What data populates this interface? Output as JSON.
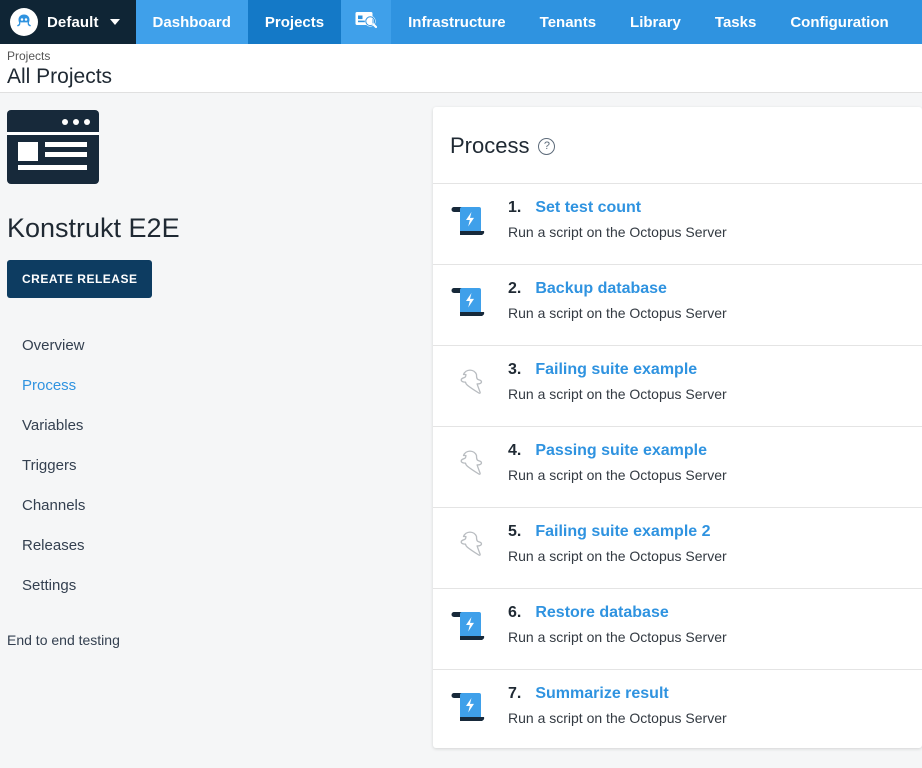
{
  "topnav": {
    "brand": {
      "label": "Default",
      "avatar_icon": "octopus-avatar-icon",
      "caret_icon": "chevron-down-icon"
    },
    "items": [
      {
        "label": "Dashboard",
        "state": "highlight"
      },
      {
        "label": "Projects",
        "state": "active"
      },
      {
        "label": "",
        "state": "highlight",
        "icon": "search-card-icon"
      },
      {
        "label": "Infrastructure",
        "state": "normal"
      },
      {
        "label": "Tenants",
        "state": "normal"
      },
      {
        "label": "Library",
        "state": "normal"
      },
      {
        "label": "Tasks",
        "state": "normal"
      },
      {
        "label": "Configuration",
        "state": "normal"
      }
    ],
    "colors": {
      "base": "#2f93e0",
      "highlight": "#3fa0ea",
      "active": "#1479c7",
      "brand_bg": "#0f2535"
    }
  },
  "pagehead": {
    "breadcrumb": "Projects",
    "title": "All Projects"
  },
  "sidebar": {
    "logo_icon": "project-window-logo-icon",
    "project_title": "Konstrukt E2E",
    "create_release_label": "CREATE RELEASE",
    "items": [
      {
        "label": "Overview",
        "selected": false
      },
      {
        "label": "Process",
        "selected": true
      },
      {
        "label": "Variables",
        "selected": false
      },
      {
        "label": "Triggers",
        "selected": false
      },
      {
        "label": "Channels",
        "selected": false
      },
      {
        "label": "Releases",
        "selected": false
      },
      {
        "label": "Settings",
        "selected": false
      }
    ],
    "note": "End to end testing"
  },
  "process_panel": {
    "title": "Process",
    "help_glyph": "?",
    "steps": [
      {
        "number": "1.",
        "name": "Set test count",
        "description": "Run a script on the Octopus Server",
        "icon": "script-step-icon"
      },
      {
        "number": "2.",
        "name": "Backup database",
        "description": "Run a script on the Octopus Server",
        "icon": "script-step-icon"
      },
      {
        "number": "3.",
        "name": "Failing suite example",
        "description": "Run a script on the Octopus Server",
        "icon": "ghost-step-icon"
      },
      {
        "number": "4.",
        "name": "Passing suite example",
        "description": "Run a script on the Octopus Server",
        "icon": "ghost-step-icon"
      },
      {
        "number": "5.",
        "name": "Failing suite example 2",
        "description": "Run a script on the Octopus Server",
        "icon": "ghost-step-icon"
      },
      {
        "number": "6.",
        "name": "Restore database",
        "description": "Run a script on the Octopus Server",
        "icon": "script-step-icon"
      },
      {
        "number": "7.",
        "name": "Summarize result",
        "description": "Run a script on the Octopus Server",
        "icon": "script-step-icon"
      }
    ]
  },
  "colors": {
    "accent": "#2f93e0",
    "link": "#2f93e0",
    "dark_navy": "#0d3c61",
    "page_bg": "#f5f6f7"
  }
}
